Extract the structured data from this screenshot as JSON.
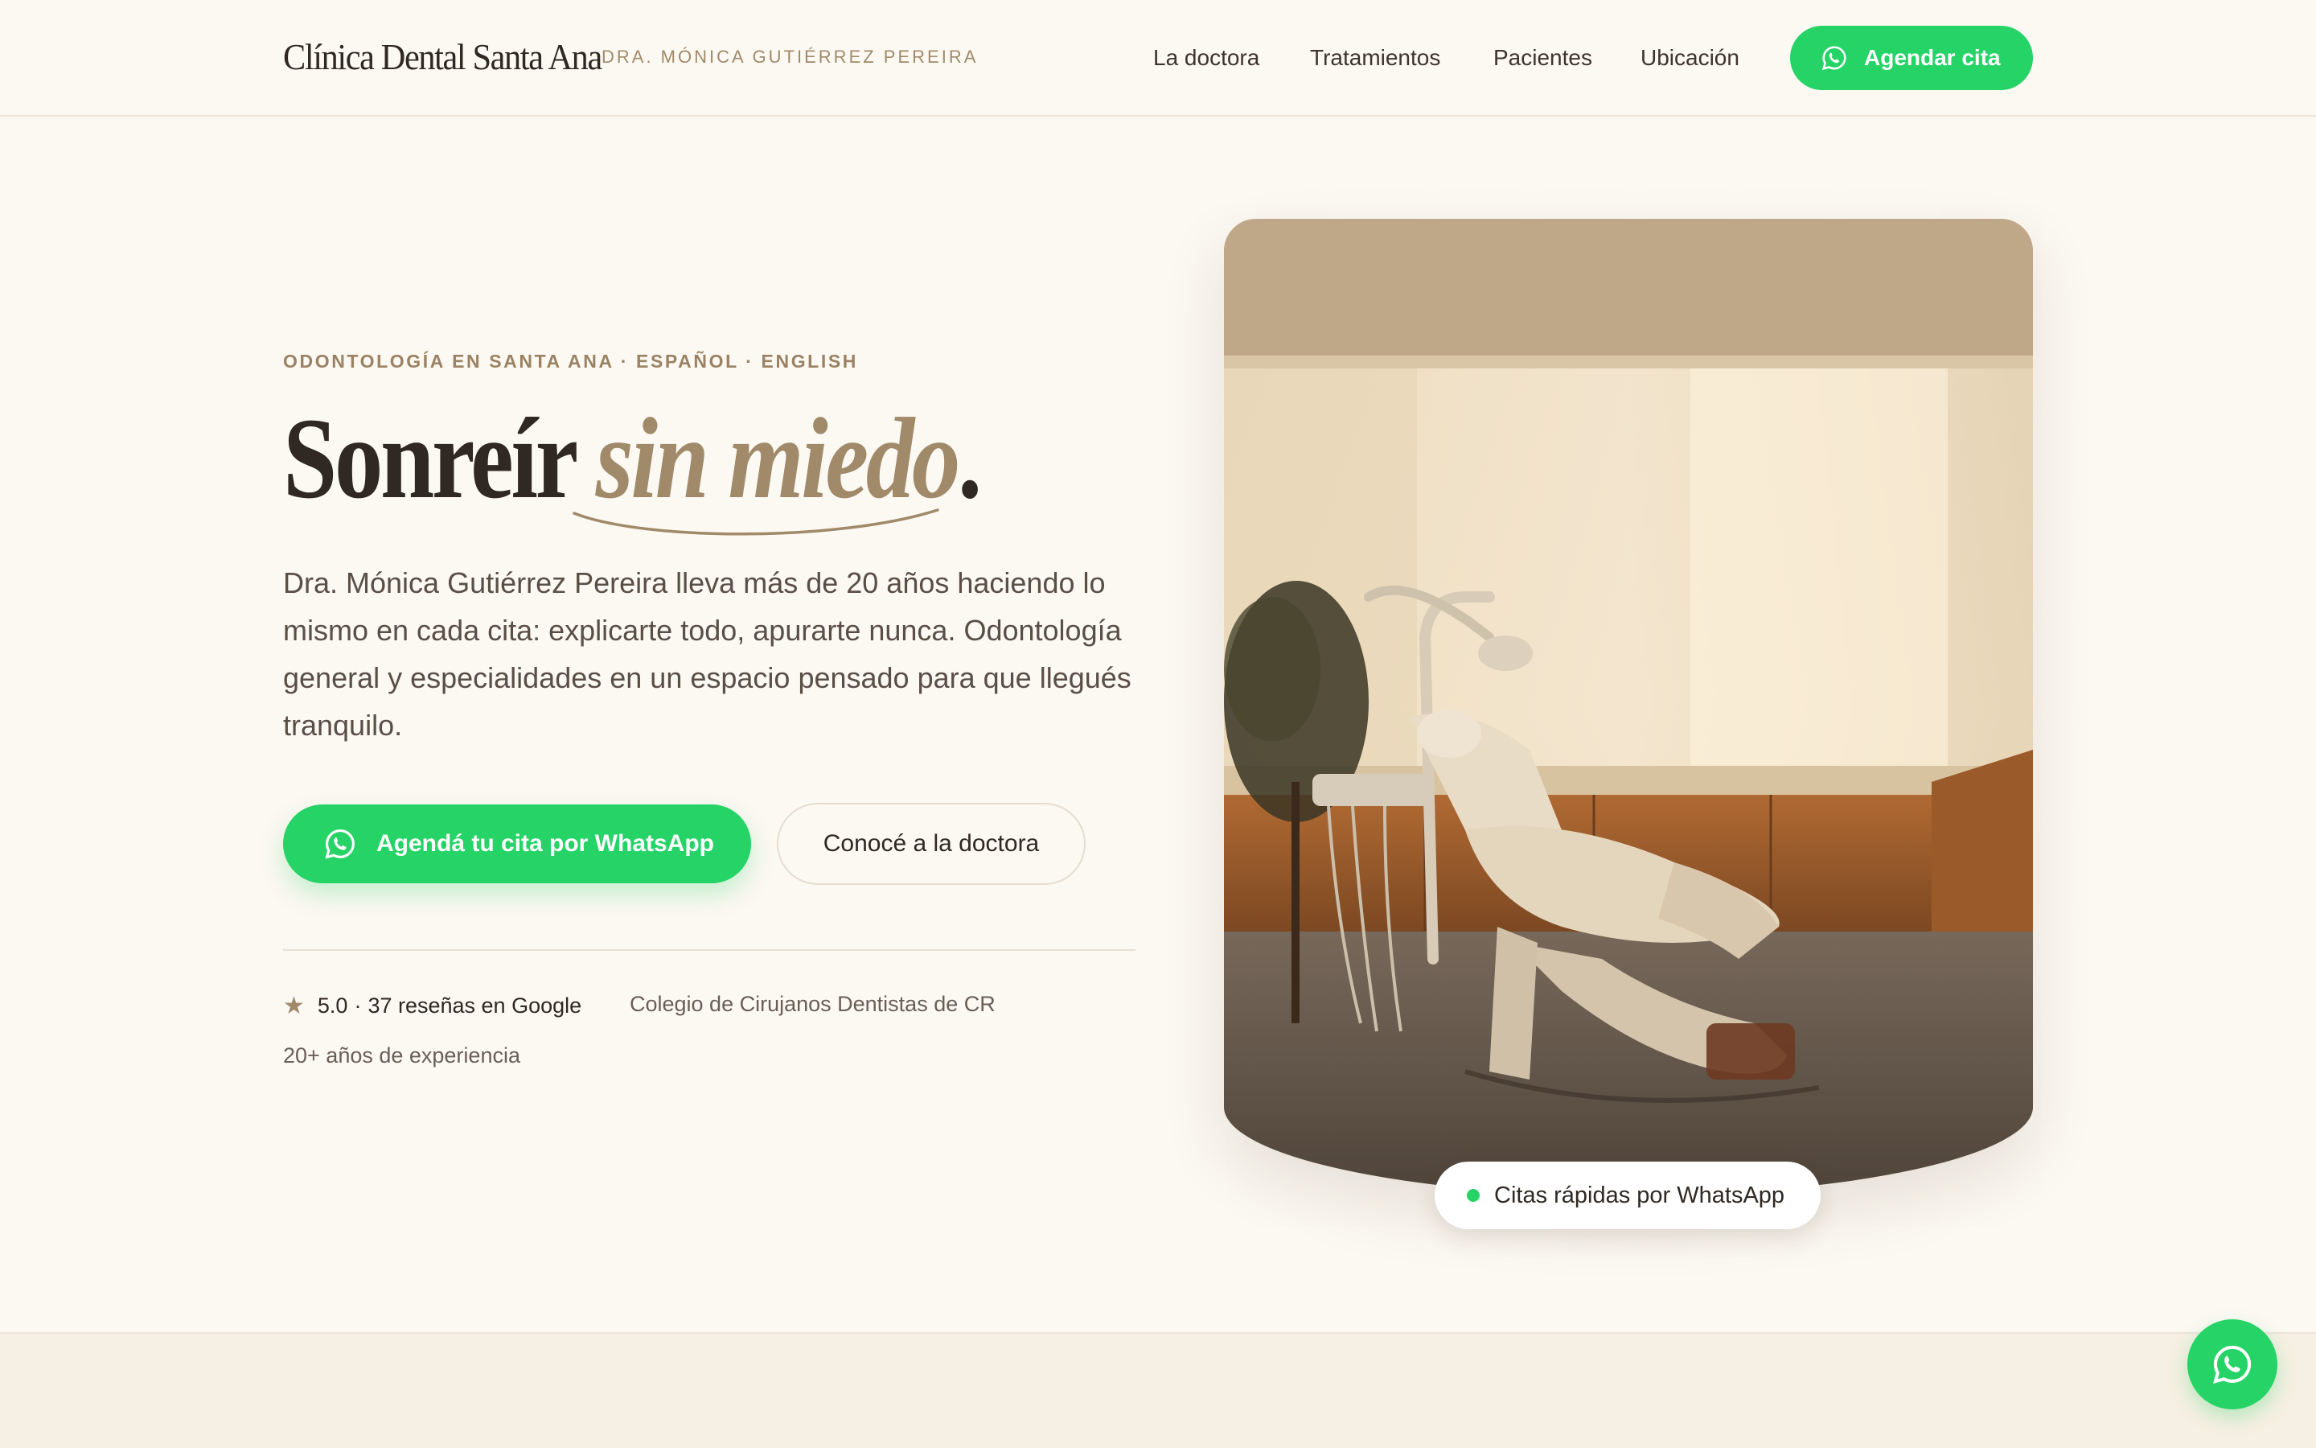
{
  "header": {
    "brand": "Clínica Dental Santa Ana",
    "doctor": "DRA. MÓNICA GUTIÉRREZ PEREIRA",
    "nav": [
      "La doctora",
      "Tratamientos",
      "Pacientes",
      "Ubicación"
    ],
    "cta": "Agendar cita"
  },
  "hero": {
    "eyebrow": "ODONTOLOGÍA EN SANTA ANA · ESPAÑOL · ENGLISH",
    "title_main": "Sonreír ",
    "title_accent": "sin miedo",
    "title_end": ".",
    "body": "Dra. Mónica Gutiérrez Pereira lleva más de 20 años haciendo lo mismo en cada cita: explicarte todo, apurarte nunca. Odontología general y especialidades en un espacio pensado para que llegués tranquilo.",
    "cta_primary": "Agendá tu cita por WhatsApp",
    "cta_secondary": "Conocé a la doctora",
    "rating_score": "5.0",
    "rating_sep": "·",
    "rating_reviews": "37 reseñas en Google",
    "trust_college": "Colegio de Cirujanos Dentistas de CR",
    "trust_experience": "20+ años de experiencia",
    "photo_badge": "Citas rápidas por WhatsApp"
  },
  "icons": {
    "whatsapp": "whatsapp-icon",
    "star": "star-icon"
  },
  "colors": {
    "background": "#fcf8f2",
    "accent": "#a08a6a",
    "whatsapp_green": "#25d366",
    "text": "#2f2823"
  }
}
